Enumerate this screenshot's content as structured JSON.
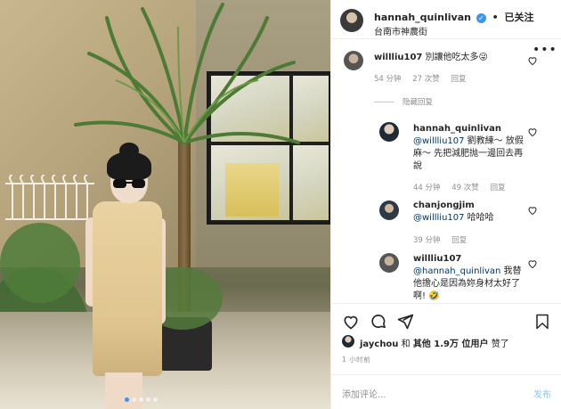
{
  "post": {
    "author": "hannah_quinlivan",
    "follow_label": "已关注",
    "separator": "•",
    "location": "台南市神農街",
    "more_label": "•••"
  },
  "comments": [
    {
      "user": "willliu107",
      "text": "別讓他吃太多😜",
      "time": "54 分钟",
      "likes": "27 次赞",
      "reply": "回复"
    }
  ],
  "hidden_replies_label": "隐藏回复",
  "replies": [
    {
      "user": "hannah_quinlivan",
      "mention": "@willliu107",
      "text": " 劉教練～ 放假麻～ 先把減肥抛一邊回去再說",
      "time": "44 分钟",
      "likes": "49 次赞",
      "reply": "回复"
    },
    {
      "user": "chanjongjim",
      "mention": "@willliu107",
      "text": " 哈哈哈",
      "time": "39 分钟",
      "likes": "",
      "reply": "回复"
    },
    {
      "user": "willliu107",
      "mention": "@hannah_quinlivan",
      "text": " 我替他擔心是因為妳身材太好了啊! 🤣",
      "time": "",
      "likes": "",
      "reply": ""
    }
  ],
  "likes": {
    "first_user": "jaychou",
    "connector": "和",
    "others": "其他 1.9万 位用户",
    "suffix": "赞了"
  },
  "timestamp": "1 小时前",
  "composer": {
    "placeholder": "添加评论...",
    "post_label": "发布"
  },
  "colors": {
    "accent": "#0095f6",
    "mention": "#00376b",
    "muted": "#8e8e8e",
    "verified": "#3897f0"
  },
  "icons": [
    "heart-icon",
    "comment-icon",
    "share-icon",
    "bookmark-icon",
    "verified-icon",
    "more-icon"
  ]
}
